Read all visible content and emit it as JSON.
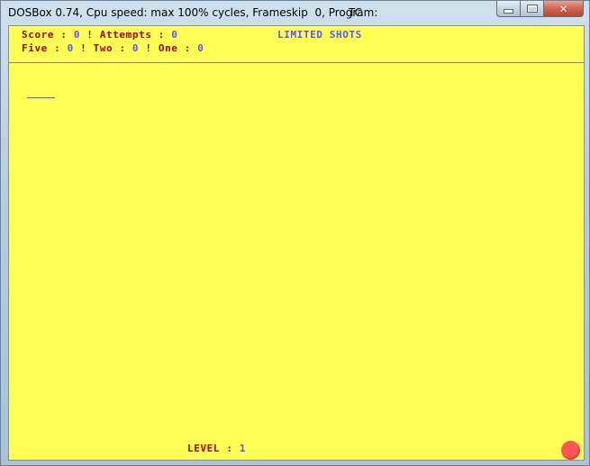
{
  "window": {
    "title": "DOSBox 0.74, Cpu speed: max 100% cycles, Frameskip  0, Program:",
    "program": "TC",
    "controls": {
      "minimize_icon": "minimize-icon",
      "maximize_icon": "maximize-icon",
      "close_icon": "close-icon"
    }
  },
  "hud": {
    "score_label": "Score",
    "score_value": "0",
    "attempts_label": "Attempts",
    "attempts_value": "0",
    "mode_text": "LIMITED SHOTS",
    "five_label": "Five",
    "five_value": "0",
    "two_label": "Two",
    "two_value": "0",
    "one_label": "One",
    "one_value": "0",
    "separator_colon": ":",
    "separator_bar": "!"
  },
  "footer": {
    "level_label": "LEVEL",
    "level_value": "1"
  },
  "colors": {
    "background": "#ffff55",
    "label": "#aa0000",
    "value": "#5555ff",
    "ball": "#ff5555"
  }
}
